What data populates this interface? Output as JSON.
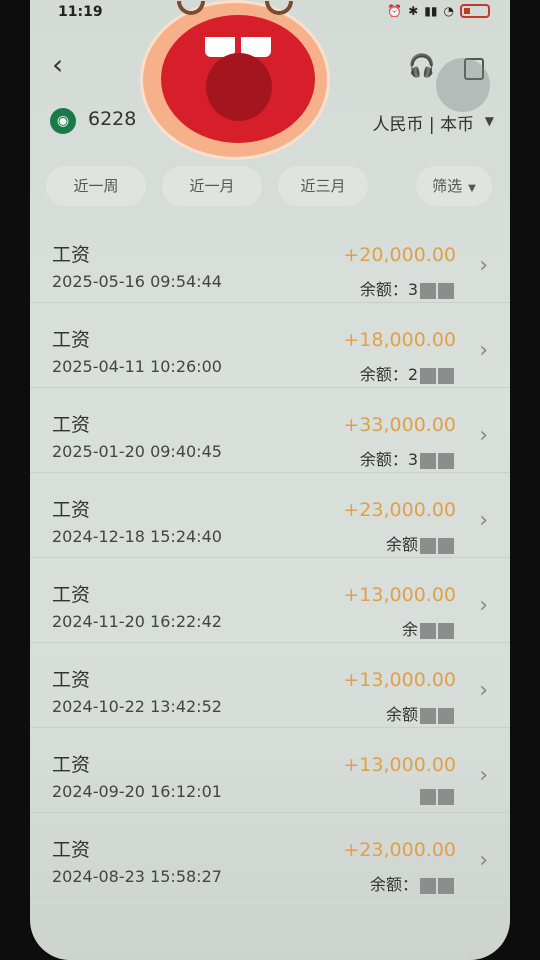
{
  "status": {
    "time": "11:19"
  },
  "header": {
    "account": "6228",
    "currency": "人民币 | 本币"
  },
  "filters": [
    {
      "label": "近一周"
    },
    {
      "label": "近一月"
    },
    {
      "label": "近三月"
    },
    {
      "label": "筛选"
    }
  ],
  "transactions": [
    {
      "title": "工资",
      "date": "2025-05-16 09:54:44",
      "amount": "+20,000.00",
      "balance": "余额：3"
    },
    {
      "title": "工资",
      "date": "2025-04-11 10:26:00",
      "amount": "+18,000.00",
      "balance": "余额：2"
    },
    {
      "title": "工资",
      "date": "2025-01-20 09:40:45",
      "amount": "+33,000.00",
      "balance": "余额：3"
    },
    {
      "title": "工资",
      "date": "2024-12-18 15:24:40",
      "amount": "+23,000.00",
      "balance": "余额"
    },
    {
      "title": "工资",
      "date": "2024-11-20 16:22:42",
      "amount": "+13,000.00",
      "balance": "余"
    },
    {
      "title": "工资",
      "date": "2024-10-22 13:42:52",
      "amount": "+13,000.00",
      "balance": "余额"
    },
    {
      "title": "工资",
      "date": "2024-09-20 16:12:01",
      "amount": "+13,000.00",
      "balance": ""
    },
    {
      "title": "工资",
      "date": "2024-08-23 15:58:27",
      "amount": "+23,000.00",
      "balance": "余额："
    }
  ],
  "colors": {
    "amount": "#e0a04a",
    "bank_logo": "#1a7b48",
    "emoji_red": "#d61f2a"
  }
}
